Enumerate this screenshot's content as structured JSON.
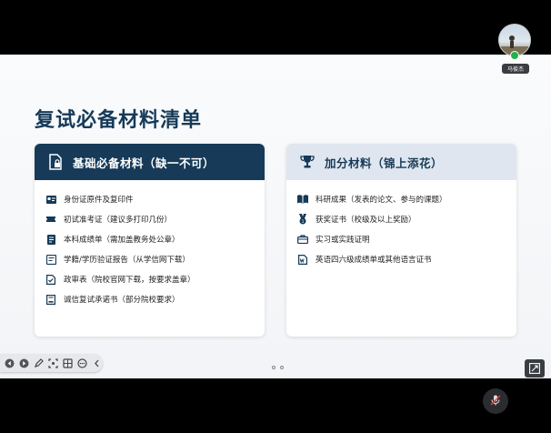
{
  "slide": {
    "title": "复试必备材料清单",
    "basic_card": {
      "header": "基础必备材料（缺一不可）",
      "items": [
        {
          "label": "身份证原件及复印件",
          "icon": "id-card-icon"
        },
        {
          "label": "初试准考证（建议多打印几份）",
          "icon": "ticket-icon"
        },
        {
          "label": "本科成绩单（需加盖教务处公章）",
          "icon": "transcript-icon"
        },
        {
          "label": "学籍/学历验证报告（从学信网下载）",
          "icon": "certificate-icon"
        },
        {
          "label": "政审表（院校官网下载，按要求盖章）",
          "icon": "checked-document-icon"
        },
        {
          "label": "诚信复试承诺书（部分院校要求）",
          "icon": "pledge-document-icon"
        }
      ]
    },
    "bonus_card": {
      "header": "加分材料（锦上添花）",
      "items": [
        {
          "label": "科研成果（发表的论文、参与的课题）",
          "icon": "book-icon"
        },
        {
          "label": "获奖证书（校级及以上奖励）",
          "icon": "medal-icon"
        },
        {
          "label": "实习或实践证明",
          "icon": "briefcase-icon"
        },
        {
          "label": "英语四六级成绩单或其他语言证书",
          "icon": "word-document-icon"
        }
      ]
    }
  },
  "participant": {
    "name": "马俊杰"
  },
  "colors": {
    "primary": "#163a58",
    "bonus_header_bg": "#dfe6ef",
    "mic_active": "#22b14c"
  }
}
